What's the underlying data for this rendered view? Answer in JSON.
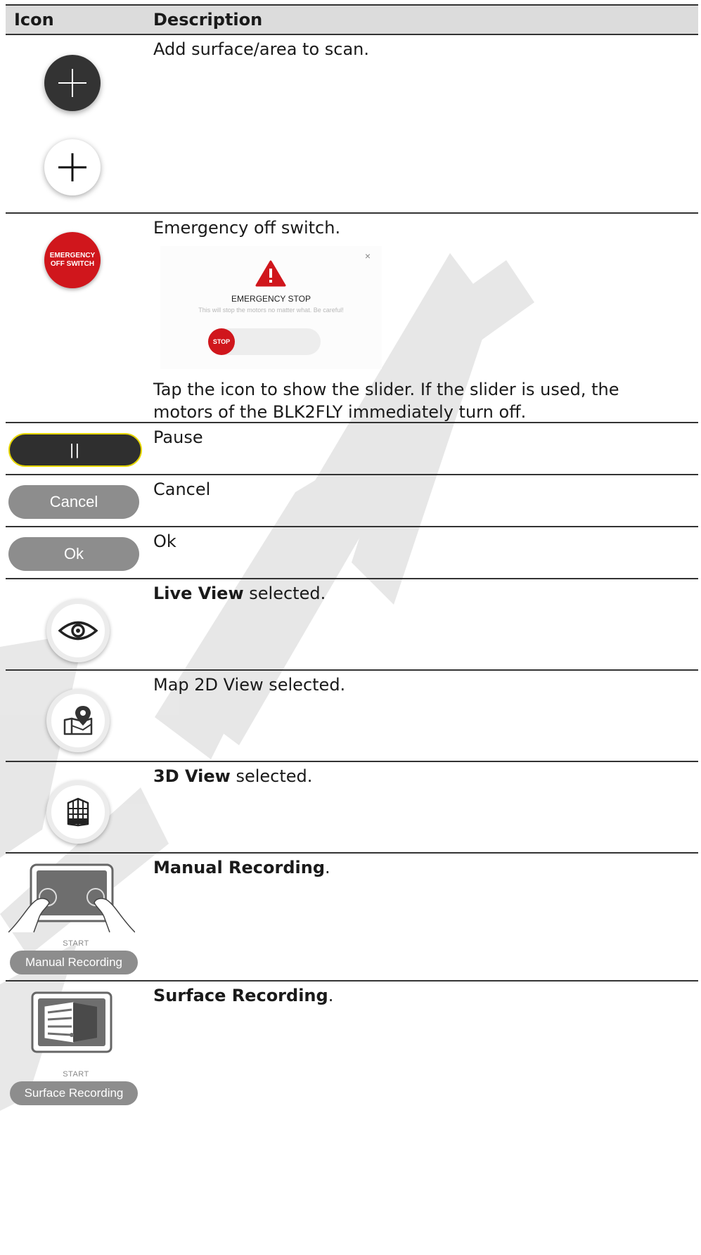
{
  "header": {
    "icon_col": "Icon",
    "desc_col": "Description"
  },
  "rows": [
    {
      "desc": "Add surface/area to scan.",
      "icons": [
        "plus-dark-icon",
        "plus-light-icon"
      ]
    },
    {
      "desc": "Emergency off switch.",
      "switch_label_1": "EMERGENCY",
      "switch_label_2": "OFF SWITCH",
      "dialog": {
        "title": "EMERGENCY STOP",
        "message": "This will stop the motors no matter what. Be careful!",
        "stop_label": "STOP",
        "close": "×"
      },
      "desc2": "Tap the icon to show the slider. If the slider is used, the motors of the BLK2FLY immediately turn off."
    },
    {
      "desc": "Pause",
      "button": "||"
    },
    {
      "desc": "Cancel",
      "button": "Cancel"
    },
    {
      "desc": "Ok",
      "button": "Ok"
    },
    {
      "desc_bold": "Live View",
      "desc_rest": " selected."
    },
    {
      "desc": "Map 2D View selected."
    },
    {
      "desc_bold": "3D View",
      "desc_rest": " selected."
    },
    {
      "desc_bold": "Manual Recording",
      "desc_rest": ".",
      "start": "START",
      "button": "Manual Recording"
    },
    {
      "desc_bold": "Surface Recording",
      "desc_rest": ".",
      "start": "START",
      "button": "Surface Recording"
    }
  ],
  "colors": {
    "header_bg": "#dcdcdc",
    "emergency_red": "#d0161c",
    "pause_outline": "#e6d600",
    "button_gray": "#8d8d8d"
  },
  "watermark": "DRAFT"
}
